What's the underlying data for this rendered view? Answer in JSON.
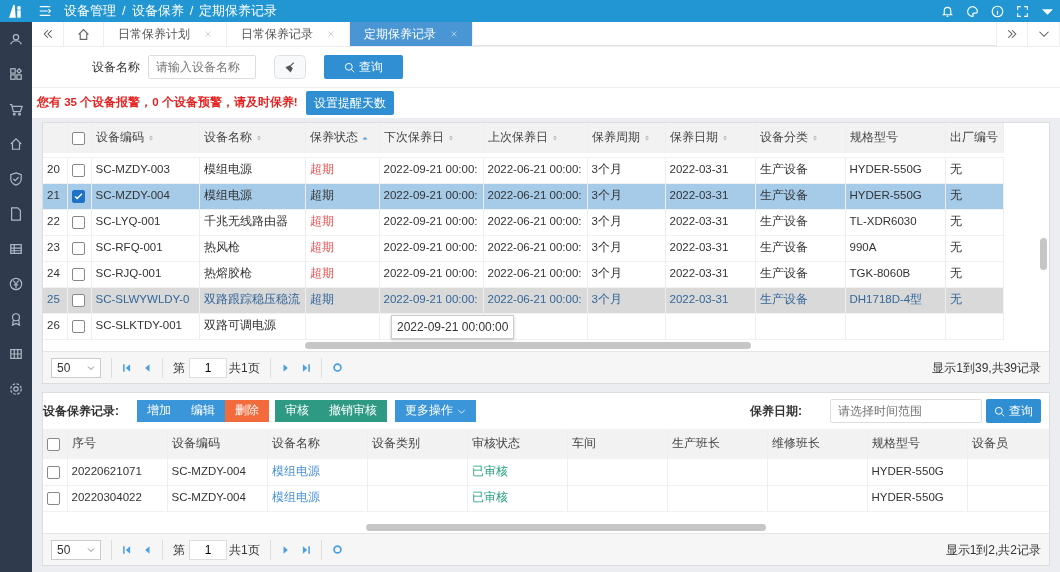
{
  "breadcrumb": [
    {
      "label": "设备管理"
    },
    {
      "separator": "/",
      "label": "设备保养"
    },
    {
      "separator": "/",
      "label": "定期保养记录"
    }
  ],
  "tabs": [
    {
      "label": "日常保养计划",
      "selected": false
    },
    {
      "label": "日常保养记录",
      "selected": false
    },
    {
      "label": "定期保养记录",
      "selected": true
    }
  ],
  "search": {
    "label": "设备名称",
    "placeholder": "请输入设备名称",
    "button": "查询"
  },
  "alert": {
    "text": "您有 35 个设备报警，0 个设备预警，请及时保养!",
    "button": "设置提醒天数"
  },
  "table": {
    "all_checked": false,
    "columns": [
      {
        "label": "设备编码",
        "kind": "sortable"
      },
      {
        "label": "设备名称",
        "kind": "sortable"
      },
      {
        "label": "保养状态",
        "kind": "ascending"
      },
      {
        "label": "下次保养日",
        "kind": "sortable"
      },
      {
        "label": "上次保养日",
        "kind": "sortable"
      },
      {
        "label": "保养周期",
        "kind": "sortable"
      },
      {
        "label": "保养日期",
        "kind": "sortable"
      },
      {
        "label": "设备分类",
        "kind": "sortable"
      },
      {
        "label": "规格型号",
        "kind": "plain"
      },
      {
        "label": "出厂编号",
        "kind": "plain"
      }
    ],
    "rows": [
      {
        "num": "20",
        "checked": false,
        "selected": false,
        "hovered": false,
        "cells": [
          "SC-MZDY-003",
          "模组电源",
          "超期",
          "2022-09-21 00:00:",
          "2022-06-21 00:00:",
          "3个月",
          "2022-03-31",
          "生产设备",
          "HYDER-550G",
          "无"
        ]
      },
      {
        "num": "21",
        "checked": true,
        "selected": true,
        "hovered": false,
        "cells": [
          "SC-MZDY-004",
          "模组电源",
          "超期",
          "2022-09-21 00:00:",
          "2022-06-21 00:00:",
          "3个月",
          "2022-03-31",
          "生产设备",
          "HYDER-550G",
          "无"
        ]
      },
      {
        "num": "22",
        "checked": false,
        "selected": false,
        "hovered": false,
        "cells": [
          "SC-LYQ-001",
          "千兆无线路由器",
          "超期",
          "2022-09-21 00:00:",
          "2022-06-21 00:00:",
          "3个月",
          "2022-03-31",
          "生产设备",
          "TL-XDR6030",
          "无"
        ]
      },
      {
        "num": "23",
        "checked": false,
        "selected": false,
        "hovered": false,
        "cells": [
          "SC-RFQ-001",
          "热风枪",
          "超期",
          "2022-09-21 00:00:",
          "2022-06-21 00:00:",
          "3个月",
          "2022-03-31",
          "生产设备",
          "990A",
          "无"
        ]
      },
      {
        "num": "24",
        "checked": false,
        "selected": false,
        "hovered": false,
        "cells": [
          "SC-RJQ-001",
          "热熔胶枪",
          "超期",
          "2022-09-21 00:00:",
          "2022-06-21 00:00:",
          "3个月",
          "2022-03-31",
          "生产设备",
          "TGK-8060B",
          "无"
        ]
      },
      {
        "num": "25",
        "checked": false,
        "selected": false,
        "hovered": true,
        "cells": [
          "SC-SLWYWLDY-0",
          "双路跟踪稳压稳流",
          "超期",
          "2022-09-21 00:00:",
          "2022-06-21 00:00:",
          "3个月",
          "2022-03-31",
          "生产设备",
          "DH1718D-4型",
          "无"
        ]
      },
      {
        "num": "26",
        "checked": false,
        "selected": false,
        "hovered": false,
        "cells": [
          "SC-SLKTDY-001",
          "双路可调电源"
        ]
      }
    ],
    "tooltip": "2022-09-21 00:00:00",
    "pager": {
      "page_size": "50",
      "page_label": "第",
      "page": "1",
      "total_pages": "共1页",
      "summary": "显示1到39,共39记录"
    }
  },
  "records": {
    "title": "设备保养记录:",
    "buttons": [
      {
        "label": "增加",
        "kind": "primary"
      },
      {
        "label": "编辑",
        "kind": "primary"
      },
      {
        "label": "删除",
        "kind": "danger"
      },
      {
        "label": "审核",
        "kind": "success"
      },
      {
        "label": "撤销审核",
        "kind": "success"
      },
      {
        "label": "更多操作",
        "kind": "dropdown"
      }
    ],
    "all_checked": false,
    "date_label": "保养日期:",
    "date_placeholder": "请选择时间范围",
    "search_button": "查询",
    "columns": [
      "序号",
      "设备编码",
      "设备名称",
      "设备类别",
      "审核状态",
      "车间",
      "生产班长",
      "维修班长",
      "规格型号",
      "设备员"
    ],
    "rows": [
      {
        "checked": false,
        "cells": [
          "20220621071",
          "SC-MZDY-004",
          "模组电源",
          "",
          "已审核",
          "",
          "",
          "",
          "HYDER-550G",
          ""
        ]
      },
      {
        "checked": false,
        "cells": [
          "20220304022",
          "SC-MZDY-004",
          "模组电源",
          "",
          "已审核",
          "",
          "",
          "",
          "HYDER-550G",
          ""
        ]
      }
    ],
    "pager": {
      "page_size": "50",
      "page_label": "第",
      "page": "1",
      "total_pages": "共1页",
      "summary": "显示1到2,共2记录"
    }
  }
}
